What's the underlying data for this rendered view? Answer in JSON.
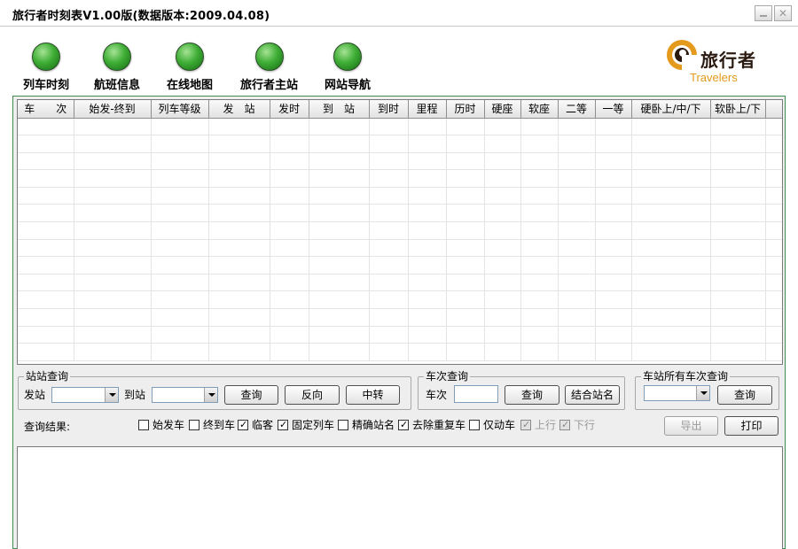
{
  "window": {
    "title": "旅行者时刻表V1.00版(数据版本:2009.04.08)",
    "minimize_icon": "minimize-icon",
    "close_icon": "close-icon"
  },
  "nav": {
    "items": [
      {
        "label": "列车时刻",
        "icon": "green-ball-icon"
      },
      {
        "label": "航班信息",
        "icon": "green-ball-icon"
      },
      {
        "label": "在线地图",
        "icon": "green-ball-icon"
      },
      {
        "label": "旅行者主站",
        "icon": "green-ball-icon"
      },
      {
        "label": "网站导航",
        "icon": "green-ball-icon"
      }
    ]
  },
  "logo": {
    "text": "旅行者",
    "subtitle": "Travelers",
    "icon": "spiral-logo-icon",
    "brand_color": "#e49a1c"
  },
  "table": {
    "columns": [
      "车　　次",
      "始发-终到",
      "列车等级",
      "发　站",
      "发时",
      "到　站",
      "到时",
      "里程",
      "历时",
      "硬座",
      "软座",
      "二等",
      "一等",
      "硬卧上/中/下",
      "软卧上/下"
    ],
    "rows": []
  },
  "station_query": {
    "legend": "站站查询",
    "from_label": "发站",
    "from_value": "",
    "to_label": "到站",
    "to_value": "",
    "query_button": "查询",
    "reverse_button": "反向",
    "transfer_button": "中转"
  },
  "train_query": {
    "legend": "车次查询",
    "train_label": "车次",
    "train_value": "",
    "query_button": "查询",
    "combine_button": "结合站名"
  },
  "station_all_query": {
    "legend": "车站所有车次查询",
    "station_value": "",
    "query_button": "查询"
  },
  "results": {
    "label": "查询结果:",
    "export_button": "导出",
    "print_button": "打印",
    "checkboxes": [
      {
        "label": "始发车",
        "checked": false,
        "enabled": true
      },
      {
        "label": "终到车",
        "checked": false,
        "enabled": true
      },
      {
        "label": "临客",
        "checked": true,
        "enabled": true
      },
      {
        "label": "固定列车",
        "checked": true,
        "enabled": true
      },
      {
        "label": "精确站名",
        "checked": false,
        "enabled": true
      },
      {
        "label": "去除重复车",
        "checked": true,
        "enabled": true
      },
      {
        "label": "仅动车",
        "checked": false,
        "enabled": true
      },
      {
        "label": "上行",
        "checked": true,
        "enabled": false
      },
      {
        "label": "下行",
        "checked": true,
        "enabled": false
      }
    ]
  },
  "colors": {
    "nav_ball": "#3fae36",
    "frame_border": "#3c8f50",
    "panel_bg": "#eeeeee"
  }
}
